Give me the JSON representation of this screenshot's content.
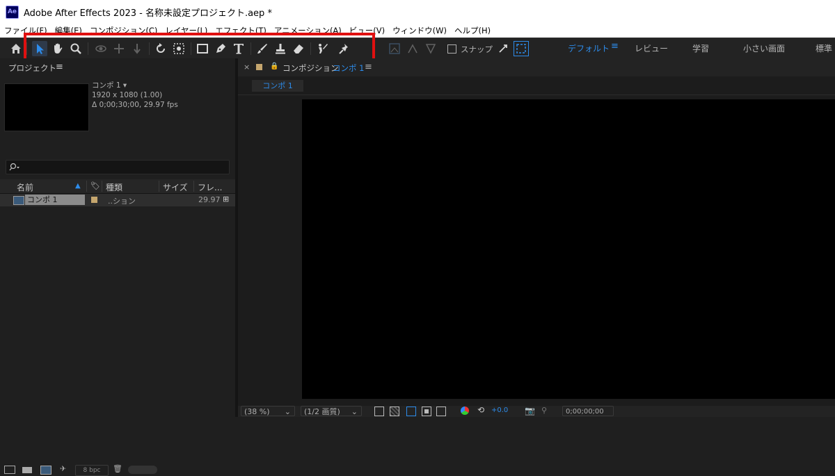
{
  "window": {
    "app_badge": "Ae",
    "title": "Adobe After Effects 2023 - 名称未設定プロジェクト.aep *"
  },
  "menu": [
    "ファイル(F)",
    "編集(E)",
    "コンポジション(C)",
    "レイヤー(L)",
    "エフェクト(T)",
    "アニメーション(A)",
    "ビュー(V)",
    "ウィンドウ(W)",
    "ヘルプ(H)"
  ],
  "toolbar": {
    "tools": [
      "home-icon",
      "selection-tool-icon",
      "hand-tool-icon",
      "zoom-tool-icon",
      "orbit-camera-icon",
      "pan-camera-icon",
      "dolly-camera-icon",
      "rotation-tool-icon",
      "pan-behind-tool-icon",
      "rectangle-tool-icon",
      "pen-tool-icon",
      "type-tool-icon",
      "brush-tool-icon",
      "clone-stamp-tool-icon",
      "eraser-tool-icon",
      "roto-brush-tool-icon",
      "puppet-pin-tool-icon"
    ],
    "snap_label": "スナップ",
    "workspaces": {
      "active": "デフォルト",
      "items": [
        "レビュー",
        "学習",
        "小さい画面",
        "標準"
      ]
    },
    "accent_color": "#2d8ceb",
    "highlight_color": "#e01010"
  },
  "project_panel": {
    "tab_label": "プロジェクト",
    "selected_item": {
      "name": "コンポ 1 ▾",
      "dimensions": "1920 x 1080 (1.00)",
      "duration": "Δ 0;00;30;00, 29.97 fps"
    },
    "search_placeholder": "",
    "columns": [
      "名前",
      "種類",
      "サイズ",
      "フレ..."
    ],
    "rows": [
      {
        "name": "コンポ 1",
        "type": "..ション",
        "size": "",
        "frame_rate": "29.97"
      }
    ],
    "bpc_label": "8 bpc"
  },
  "composition_panel": {
    "tab_label": "コンポジション",
    "comp_name": "コンポ 1",
    "sub_tab": "コンポ 1",
    "zoom": "(38 %)",
    "resolution": "(1/2 画質)",
    "exposure": "+0.0",
    "timecode": "0;00;00;00"
  }
}
